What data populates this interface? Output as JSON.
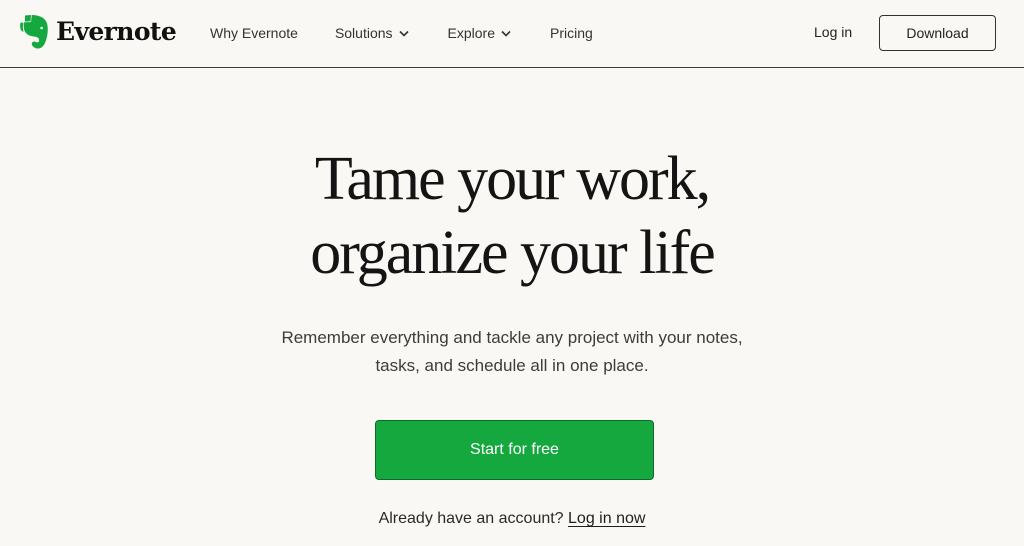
{
  "header": {
    "brand": "Evernote",
    "brand_color": "#14a83f",
    "logo_icon": "elephant-icon",
    "nav": [
      {
        "label": "Why Evernote",
        "dropdown": false
      },
      {
        "label": "Solutions",
        "dropdown": true
      },
      {
        "label": "Explore",
        "dropdown": true
      },
      {
        "label": "Pricing",
        "dropdown": false
      }
    ],
    "login_label": "Log in",
    "download_label": "Download"
  },
  "hero": {
    "title_line1": "Tame your work,",
    "title_line2": "organize your life",
    "subtitle_line1": "Remember everything and tackle any project with your notes,",
    "subtitle_line2": "tasks, and schedule all in one place.",
    "cta_label": "Start for free",
    "cta_color": "#14a83f",
    "account_prompt": "Already have an account?",
    "account_link": "Log in now"
  }
}
